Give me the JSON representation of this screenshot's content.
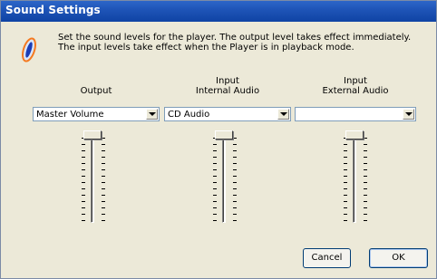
{
  "window": {
    "title": "Sound Settings"
  },
  "info": {
    "icon": "info-icon",
    "text": "Set the sound levels for the player.  The output level takes effect immediately.  The input levels take effect when the Player is in playback mode."
  },
  "columns": [
    {
      "heading_line1": "",
      "heading_line2": "Output",
      "dropdown_value": "Master Volume",
      "slider_level": 1.0
    },
    {
      "heading_line1": "Input",
      "heading_line2": "Internal Audio",
      "dropdown_value": "CD Audio",
      "slider_level": 1.0
    },
    {
      "heading_line1": "Input",
      "heading_line2": "External Audio",
      "dropdown_value": "",
      "slider_level": 1.0
    }
  ],
  "buttons": {
    "cancel": "Cancel",
    "ok": "OK"
  },
  "colors": {
    "titlebar": "#0f43a4",
    "window_bg": "#ece9d8",
    "accent_border": "#003c74"
  }
}
